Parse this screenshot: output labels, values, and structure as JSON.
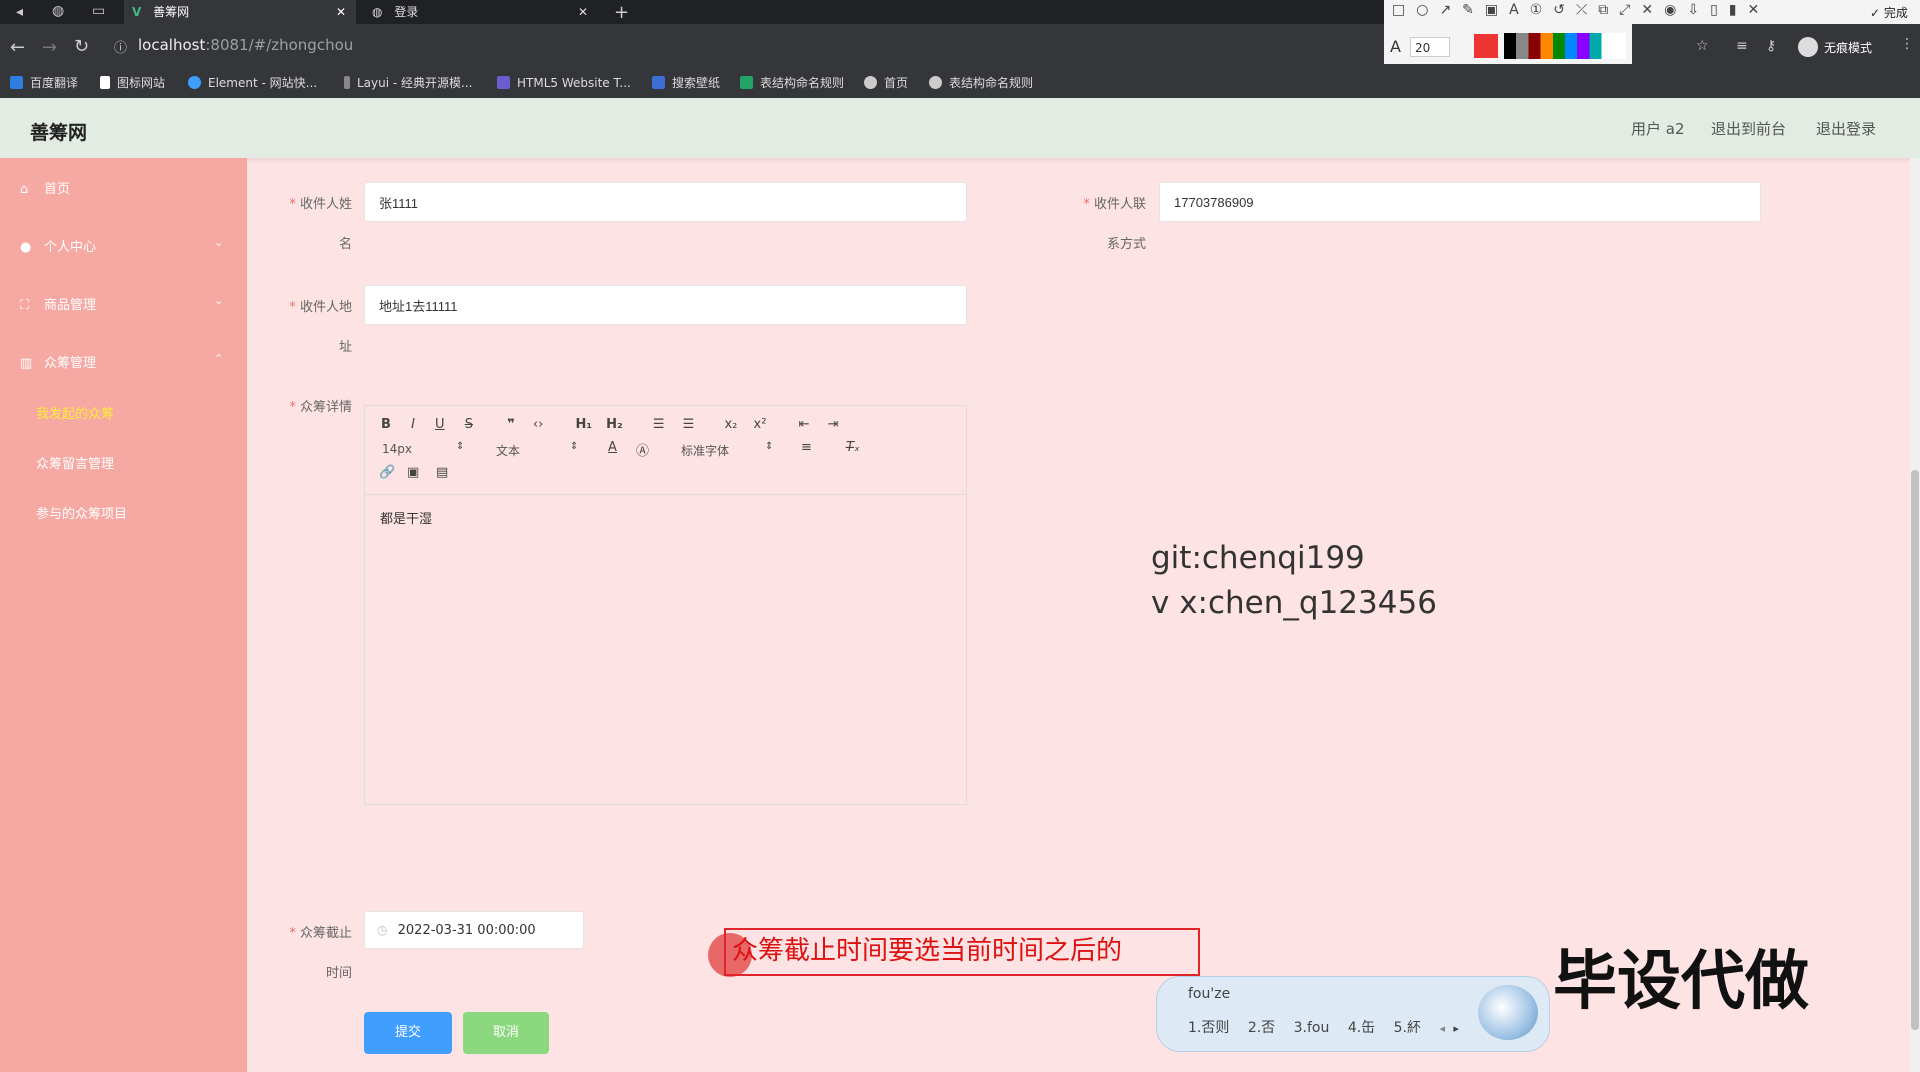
{
  "browser": {
    "tabs": [
      {
        "label": "善筹网",
        "active": true
      },
      {
        "label": "登录",
        "active": false
      }
    ],
    "url_host": "localhost",
    "url_rest": ":8081/#/zhongchou",
    "bookmarks": [
      "百度翻译",
      "图标网站",
      "Element - 网站快...",
      "Layui - 经典开源模...",
      "HTML5 Website T...",
      "搜索壁纸",
      "表结构命名规则",
      "首页",
      "表结构命名规则"
    ],
    "incognito_label": "无痕模式"
  },
  "annotation_toolbar": {
    "font_size": "20",
    "done_label": "完成"
  },
  "header": {
    "logo": "善筹网",
    "user": "用户 a2",
    "back_frontend": "退出到前台",
    "logout": "退出登录"
  },
  "sidebar": {
    "items": [
      "首页",
      "个人中心",
      "商品管理",
      "众筹管理"
    ],
    "subitems": [
      "我发起的众筹",
      "众筹留言管理",
      "参与的众筹项目"
    ]
  },
  "form": {
    "recipient_name_label_1": "收件人姓",
    "recipient_name_label_2": "名",
    "recipient_name_value": "张1111",
    "recipient_phone_label_1": "收件人联",
    "recipient_phone_label_2": "系方式",
    "recipient_phone_value": "17703786909",
    "address_label_1": "收件人地",
    "address_label_2": "址",
    "address_value": "地址1去11111",
    "detail_label": "众筹详情",
    "editor_font_size": "14px",
    "editor_header": "文本",
    "editor_font": "标准字体",
    "editor_content": "都是干湿",
    "deadline_label_1": "众筹截止",
    "deadline_label_2": "时间",
    "deadline_value": "2022-03-31 00:00:00",
    "submit": "提交",
    "cancel": "取消"
  },
  "overlay": {
    "contact_1": "git:chenqi199",
    "contact_2": "v x:chen_q123456",
    "annotation": "众筹截止时间要选当前时间之后的",
    "watermark_big": "毕设代做",
    "ime_input": "fou'ze",
    "ime_candidates": [
      "1.否则",
      "2.否",
      "3.fou",
      "4.缶",
      "5.紑"
    ]
  },
  "colors": {
    "sidebar": "#f6a9a3",
    "page": "#fde3e3",
    "header": "#e2ece2",
    "submit": "#409eff",
    "cancel": "#67c23a",
    "active_sub": "#ffeb3b"
  }
}
